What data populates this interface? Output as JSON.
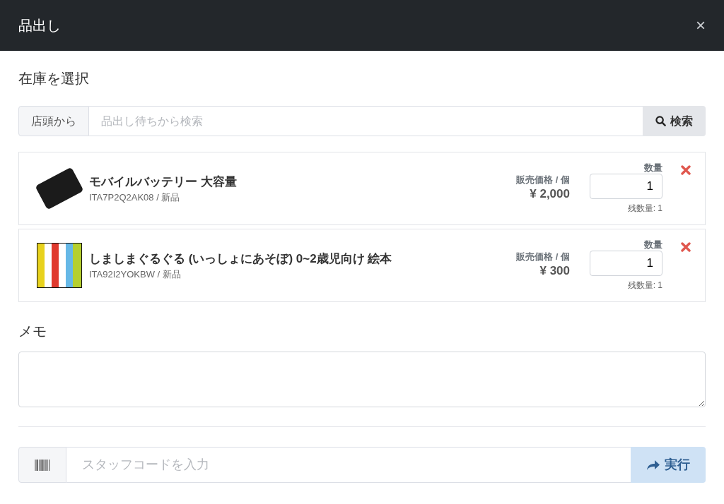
{
  "dialog": {
    "title": "品出し",
    "close": "×"
  },
  "stock_section": {
    "heading": "在庫を選択",
    "source": "店頭から",
    "search": {
      "placeholder": "品出し待ちから検索"
    },
    "search_button": "検索"
  },
  "items": [
    {
      "kind": "battery",
      "name": "モバイルバッテリー 大容量",
      "code": "ITA7P2Q2AK08 / 新品",
      "price_label": "販売価格 / 個",
      "price": "¥ 2,000",
      "qty_label": "数量",
      "qty": "1",
      "remaining": "残数量: 1"
    },
    {
      "kind": "book",
      "name": "しましまぐるぐる (いっしょにあそぼ) 0~2歳児向け 絵本",
      "code": "ITA92I2YOKBW / 新品",
      "price_label": "販売価格 / 個",
      "price": "¥ 300",
      "qty_label": "数量",
      "qty": "1",
      "remaining": "残数量: 1"
    }
  ],
  "memo": {
    "heading": "メモ"
  },
  "staff": {
    "placeholder": "スタッフコードを入力",
    "button": "実行",
    "disabled": true
  }
}
